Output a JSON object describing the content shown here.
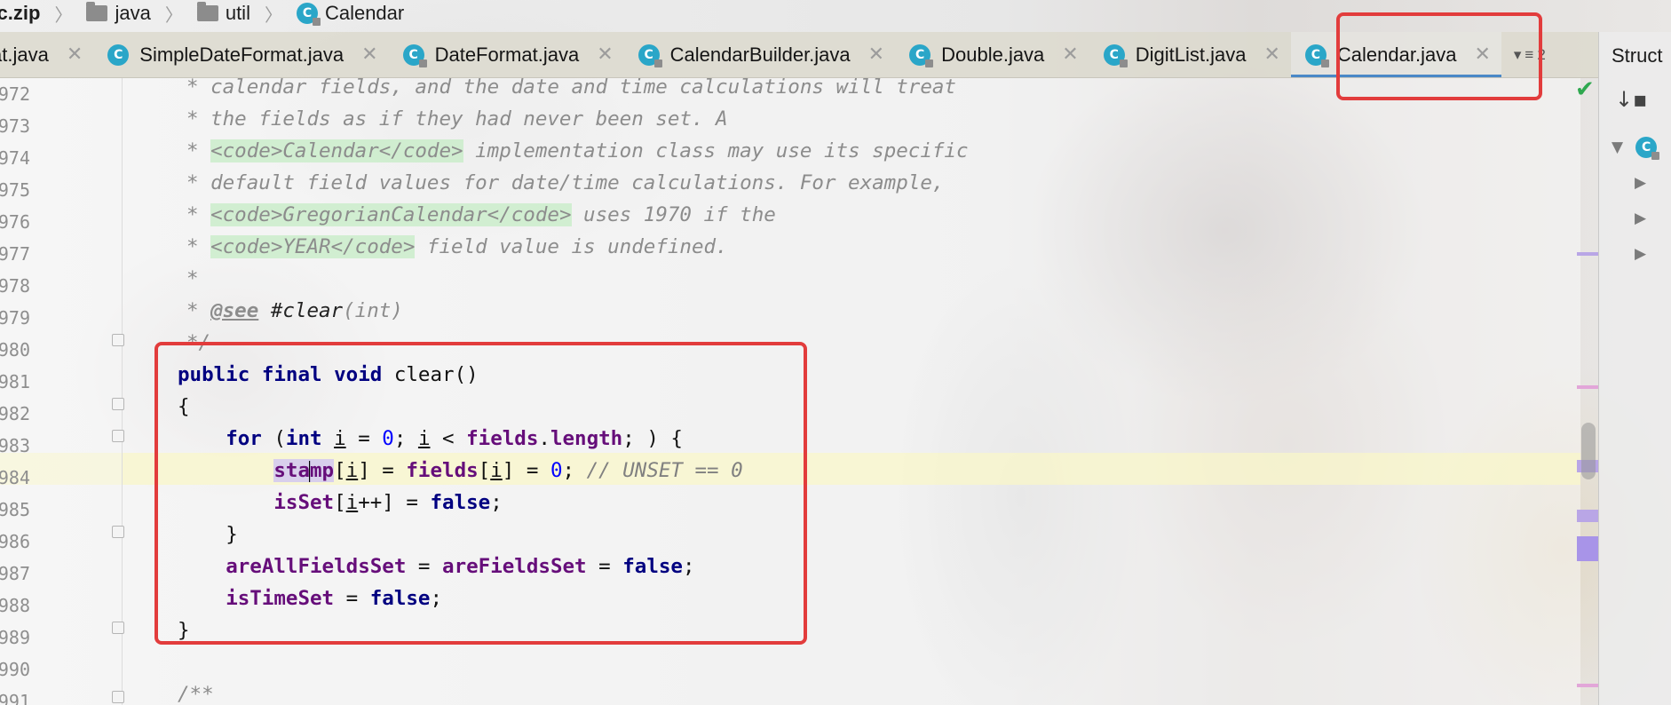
{
  "breadcrumb": {
    "items": [
      "rc.zip",
      "java",
      "util",
      "Calendar"
    ]
  },
  "tabs": [
    {
      "label": "at.java",
      "icon": "none"
    },
    {
      "label": "SimpleDateFormat.java",
      "icon": "class-icon"
    },
    {
      "label": "DateFormat.java",
      "icon": "class-icon-locked"
    },
    {
      "label": "CalendarBuilder.java",
      "icon": "class-icon-locked"
    },
    {
      "label": "Double.java",
      "icon": "class-icon-locked"
    },
    {
      "label": "DigitList.java",
      "icon": "class-icon-locked"
    },
    {
      "label": "Calendar.java",
      "icon": "class-icon-locked",
      "active": true
    }
  ],
  "tab_overflow_count": "2",
  "structure_panel": {
    "title": "Struct"
  },
  "gutter": {
    "line_numbers": [
      "972",
      "973",
      "974",
      "975",
      "976",
      "977",
      "978",
      "979",
      "980",
      "981",
      "982",
      "983",
      "984",
      "985",
      "986",
      "987",
      "988",
      "989",
      "990",
      "991"
    ]
  },
  "code": {
    "l972": "calendar fields, and the date and time calculations will treat",
    "l973": "the fields as if they had never been set. A",
    "l974_tag_open": "<code>",
    "l974_ident": "Calendar",
    "l974_tag_close": "</code>",
    "l974_rest": " implementation class may use its specific",
    "l975": "default field values for date/time calculations. For example,",
    "l976_tag_open": "<code>",
    "l976_ident": "GregorianCalendar",
    "l976_tag_close": "</code>",
    "l976_rest": " uses 1970 if the",
    "l977_tag_open": "<code>",
    "l977_ident": "YEAR",
    "l977_tag_close": "</code>",
    "l977_rest": " field value is undefined.",
    "l979_see": "@see",
    "l979_ref": "#clear",
    "l979_args": "(int)",
    "comment_star": "*",
    "comment_end": "*/",
    "kw_public": "public",
    "kw_final": "final",
    "kw_void": "void",
    "method_name": "clear()",
    "brace_open": "{",
    "brace_close": "}",
    "kw_for": "for",
    "kw_int": "int",
    "var_i": "i",
    "num_zero": "0",
    "field_fields": "fields",
    "field_length": "length",
    "field_stamp_a": "sta",
    "field_stamp_b": "mp",
    "line_comment": "// UNSET == 0",
    "field_isSet": "isSet",
    "field_areAllFieldsSet": "areAllFieldsSet",
    "field_areFieldsSet": "areFieldsSet",
    "field_isTimeSet": "isTimeSet",
    "kw_false": "false",
    "javadoc_start": "/**"
  },
  "colors": {
    "annotation": "#e23c3c",
    "keyword": "#000080",
    "field": "#660e7a",
    "number": "#0000ff",
    "active_tab_underline": "#4a88c7",
    "inspection_ok": "#2fa84f"
  }
}
